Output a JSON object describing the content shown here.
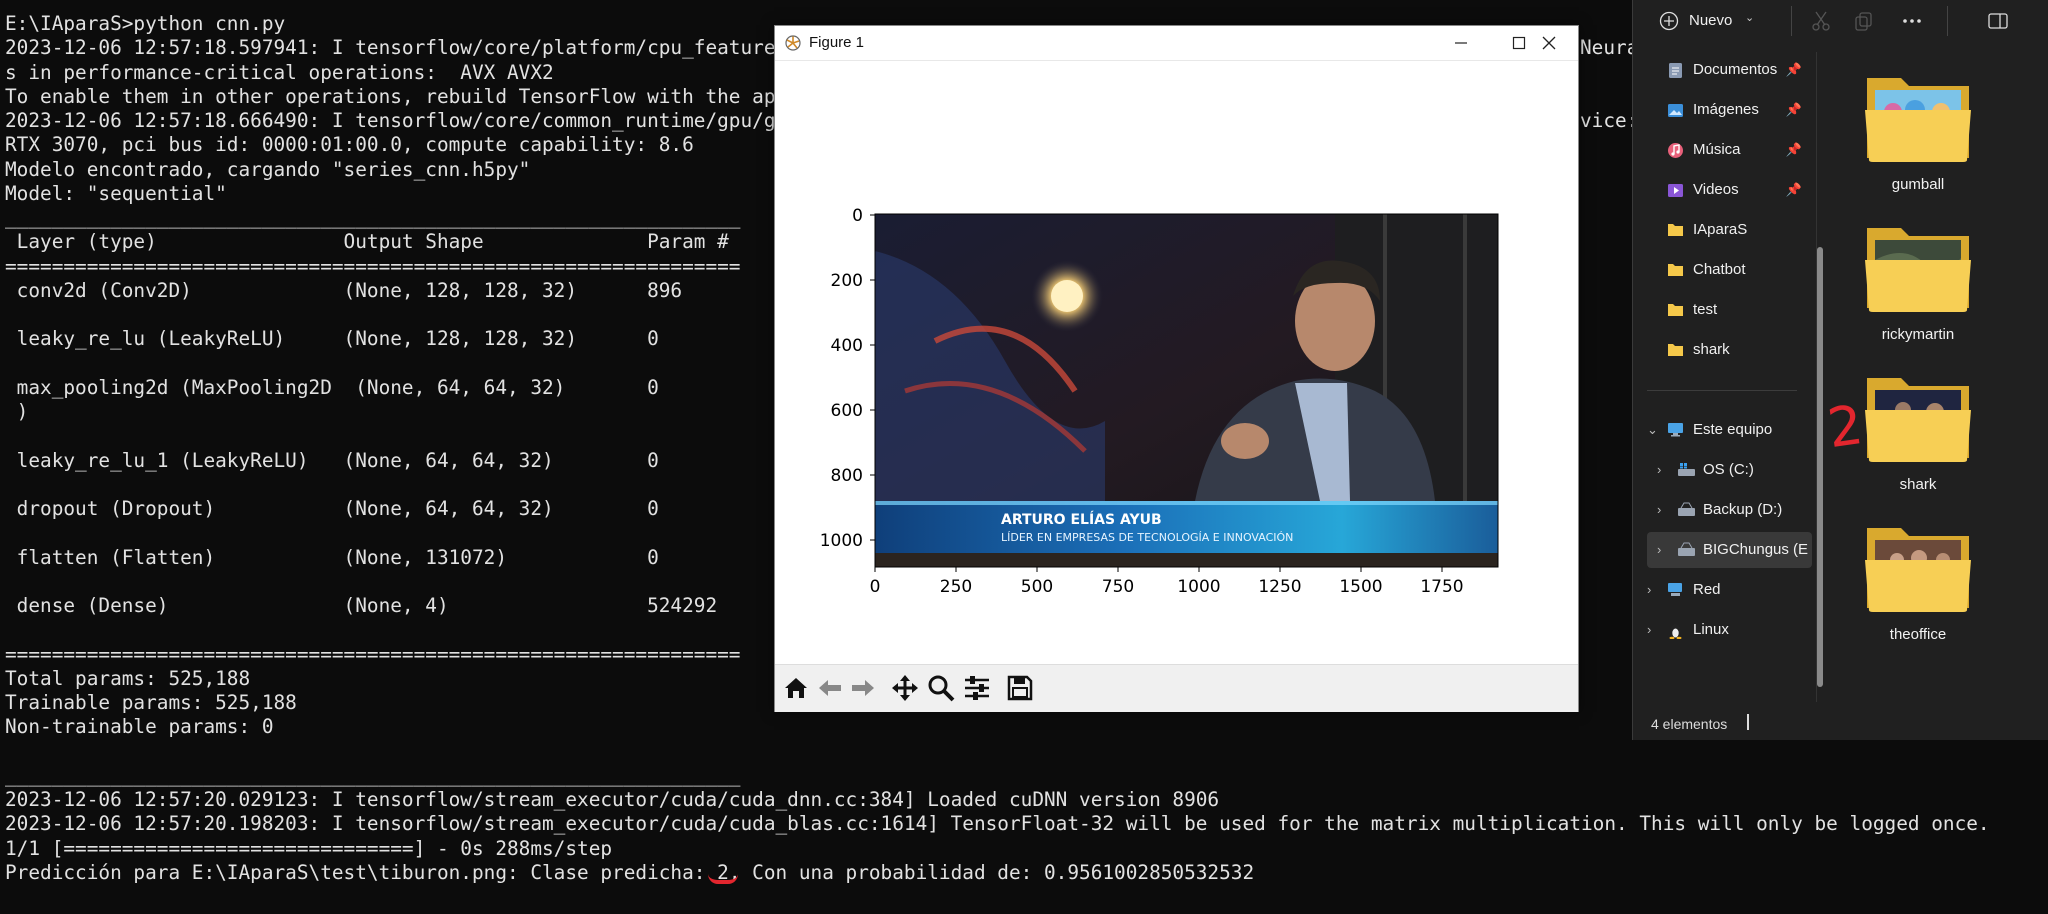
{
  "terminal": {
    "lines": [
      "E:\\IAparaS>python cnn.py",
      "2023-12-06 12:57:18.597941: I tensorflow/core/platform/cpu_feature",
      "s in performance-critical operations:  AVX AVX2",
      "To enable them in other operations, rebuild TensorFlow with the ap",
      "2023-12-06 12:57:18.666490: I tensorflow/core/common_runtime/gpu/g",
      "RTX 3070, pci bus id: 0000:01:00.0, compute capability: 8.6",
      "Modelo encontrado, cargando \"series_cnn.h5py\"",
      "Model: \"sequential\"",
      "_______________________________________________________________",
      " Layer (type)                Output Shape              Param #",
      "===============================================================",
      " conv2d (Conv2D)             (None, 128, 128, 32)      896",
      "",
      " leaky_re_lu (LeakyReLU)     (None, 128, 128, 32)      0",
      "",
      " max_pooling2d (MaxPooling2D  (None, 64, 64, 32)       0",
      " )",
      "",
      " leaky_re_lu_1 (LeakyReLU)   (None, 64, 64, 32)        0",
      "",
      " dropout (Dropout)           (None, 64, 64, 32)        0",
      "",
      " flatten (Flatten)           (None, 131072)            0",
      "",
      " dense (Dense)               (None, 4)                 524292",
      "",
      "===============================================================",
      "Total params: 525,188",
      "Trainable params: 525,188",
      "Non-trainable params: 0",
      "",
      "_______________________________________________________________",
      "2023-12-06 12:57:20.029123: I tensorflow/stream_executor/cuda/cuda_dnn.cc:384] Loaded cuDNN version 8906",
      "2023-12-06 12:57:20.198203: I tensorflow/stream_executor/cuda/cuda_blas.cc:1614] TensorFloat-32 will be used for the matrix multiplication. This will only be logged once.",
      "1/1 [==============================] - 0s 288ms/step",
      "Predicción para E:\\IAparaS\\test\\tiburon.png: Clase predicha: 2, Con una probabilidad de: 0.9561002850532532"
    ],
    "right_fragment_1": "Neura",
    "right_fragment_2": "vice:"
  },
  "figure": {
    "title": "Figure 1",
    "x_ticks": [
      "0",
      "250",
      "500",
      "750",
      "1000",
      "1250",
      "1500",
      "1750"
    ],
    "y_ticks": [
      "0",
      "200",
      "400",
      "600",
      "800",
      "1000"
    ],
    "caption_name": "ARTURO ELÍAS AYUB",
    "caption_role": "LÍDER EN EMPRESAS DE TECNOLOGÍA E INNOVACIÓN",
    "toolbar_icons": [
      "home-icon",
      "back-icon",
      "forward-icon",
      "pan-icon",
      "zoom-icon",
      "configure-icon",
      "save-icon"
    ]
  },
  "explorer": {
    "new_button": "Nuevo",
    "nav": [
      {
        "label": "Documentos",
        "pinned": true
      },
      {
        "label": "Imágenes",
        "pinned": true
      },
      {
        "label": "Música",
        "pinned": true
      },
      {
        "label": "Videos",
        "pinned": true
      },
      {
        "label": "IAparaS",
        "pinned": false
      },
      {
        "label": "Chatbot",
        "pinned": false
      },
      {
        "label": "test",
        "pinned": false
      },
      {
        "label": "shark",
        "pinned": false
      },
      {
        "label": "Este equipo",
        "pinned": false
      },
      {
        "label": "OS (C:)",
        "pinned": false
      },
      {
        "label": "Backup (D:)",
        "pinned": false
      },
      {
        "label": "BIGChungus (E",
        "pinned": false
      },
      {
        "label": "Red",
        "pinned": false
      },
      {
        "label": "Linux",
        "pinned": false
      }
    ],
    "folders": [
      "gumball",
      "rickymartin",
      "shark",
      "theoffice"
    ],
    "status": "4 elementos",
    "annotation": "2"
  },
  "colors": {
    "terminal_bg": "#0c0c0c",
    "terminal_text": "#e2e2e2",
    "explorer_bg": "#202020",
    "folder_yellow": "#f5c84a",
    "annotation_red": "#e3262e"
  }
}
